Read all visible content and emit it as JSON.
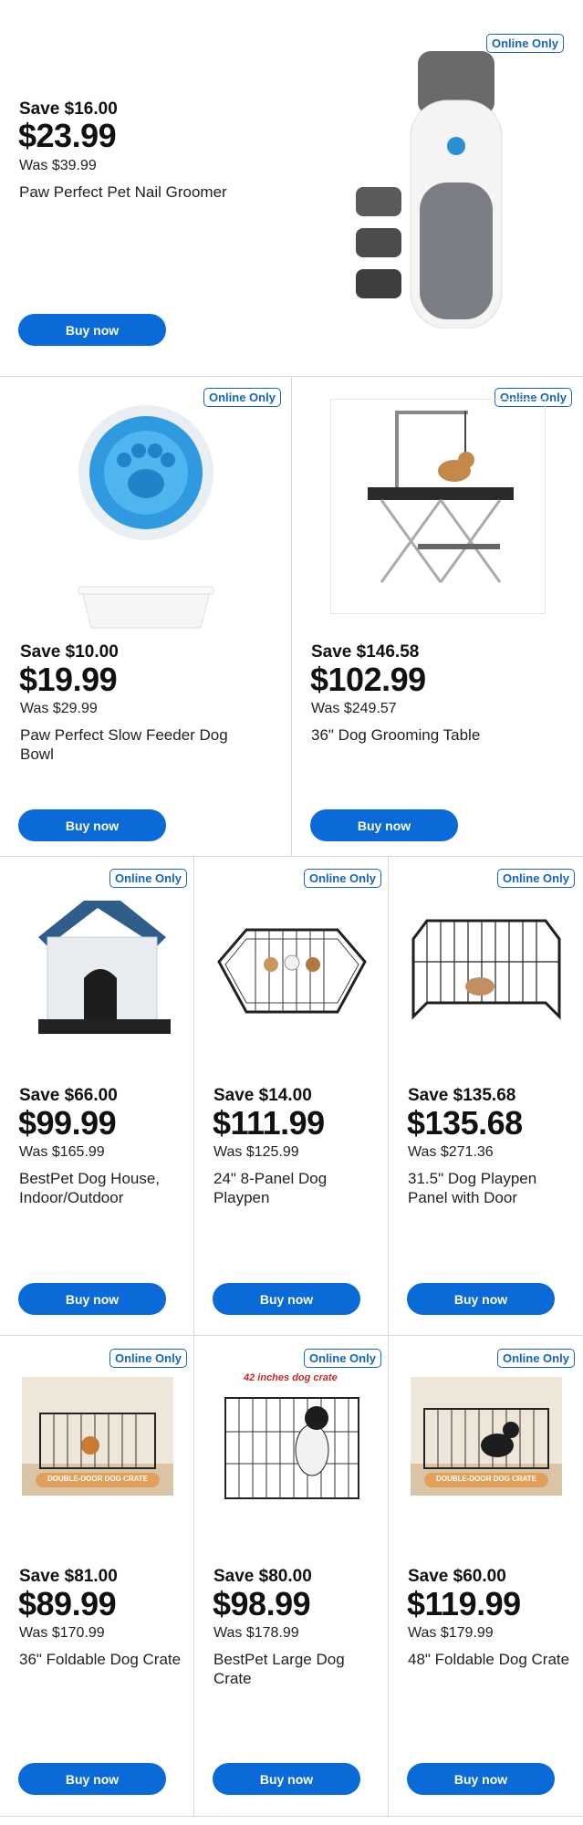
{
  "badge_text": "Online Only",
  "buy_label": "Buy now",
  "products": [
    {
      "save": "Save $16.00",
      "price": "$23.99",
      "was": "Was $39.99",
      "name": "Paw Perfect Pet Nail Groomer",
      "icon": "nail-groomer-icon"
    },
    {
      "save": "Save $10.00",
      "price": "$19.99",
      "was": "Was $29.99",
      "name": "Paw Perfect Slow Feeder Dog Bowl",
      "icon": "slow-feeder-bowl-icon"
    },
    {
      "save": "Save $146.58",
      "price": "$102.99",
      "was": "Was $249.57",
      "name": "36\" Dog Grooming Table",
      "icon": "grooming-table-icon"
    },
    {
      "save": "Save $66.00",
      "price": "$99.99",
      "was": "Was $165.99",
      "name": "BestPet Dog House, Indoor/Outdoor",
      "icon": "dog-house-icon"
    },
    {
      "save": "Save $14.00",
      "price": "$111.99",
      "was": "Was $125.99",
      "name": "24\" 8-Panel Dog Playpen",
      "icon": "playpen-icon"
    },
    {
      "save": "Save $135.68",
      "price": "$135.68",
      "was": "Was $271.36",
      "name": "31.5\" Dog Playpen Panel with Door",
      "icon": "playpen-door-icon"
    },
    {
      "save": "Save $81.00",
      "price": "$89.99",
      "was": "Was $170.99",
      "name": "36\" Foldable Dog Crate",
      "icon": "foldable-crate-icon",
      "banner": "DOUBLE-DOOR DOG CRATE"
    },
    {
      "save": "Save $80.00",
      "price": "$98.99",
      "was": "Was $178.99",
      "name": "BestPet Large Dog Crate",
      "icon": "large-crate-icon",
      "banner": "42 inches dog crate"
    },
    {
      "save": "Save $60.00",
      "price": "$119.99",
      "was": "Was $179.99",
      "name": "48\" Foldable Dog Crate",
      "icon": "foldable-crate-48-icon",
      "banner": "DOUBLE-DOOR DOG CRATE"
    }
  ]
}
